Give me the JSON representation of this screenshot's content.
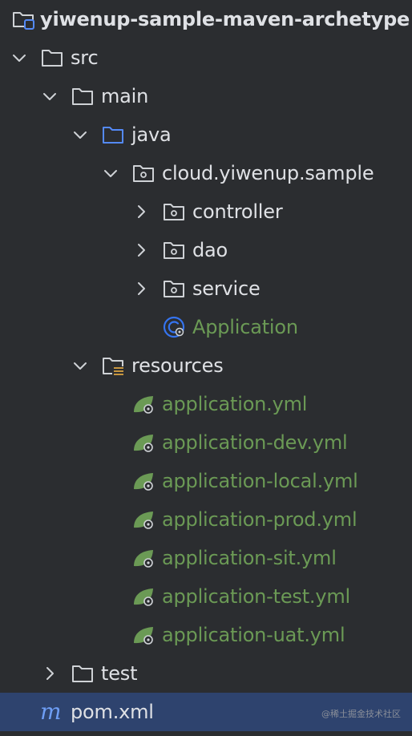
{
  "project": {
    "name": "yiwenup-sample-maven-archetype",
    "icon": "module-folder-icon"
  },
  "folders": {
    "src": "src",
    "main": "main",
    "java": "java",
    "package": "cloud.yiwenup.sample",
    "controller": "controller",
    "dao": "dao",
    "service": "service",
    "resources": "resources",
    "test": "test"
  },
  "classes": {
    "application": "Application"
  },
  "config_files": [
    "application.yml",
    "application-dev.yml",
    "application-local.yml",
    "application-prod.yml",
    "application-sit.yml",
    "application-test.yml",
    "application-uat.yml"
  ],
  "pom": {
    "name": "pom.xml",
    "icon_letter": "m"
  },
  "watermark": "@稀土掘金技术社区",
  "colors": {
    "background": "#2b2d30",
    "selection": "#2e436e",
    "text": "#dfe1e5",
    "green_text": "#6b9a55",
    "folder_stroke": "#cfd2d6",
    "source_folder_stroke": "#548af7",
    "class_icon": "#3574f0",
    "spring_leaf": "#6b9a55"
  }
}
